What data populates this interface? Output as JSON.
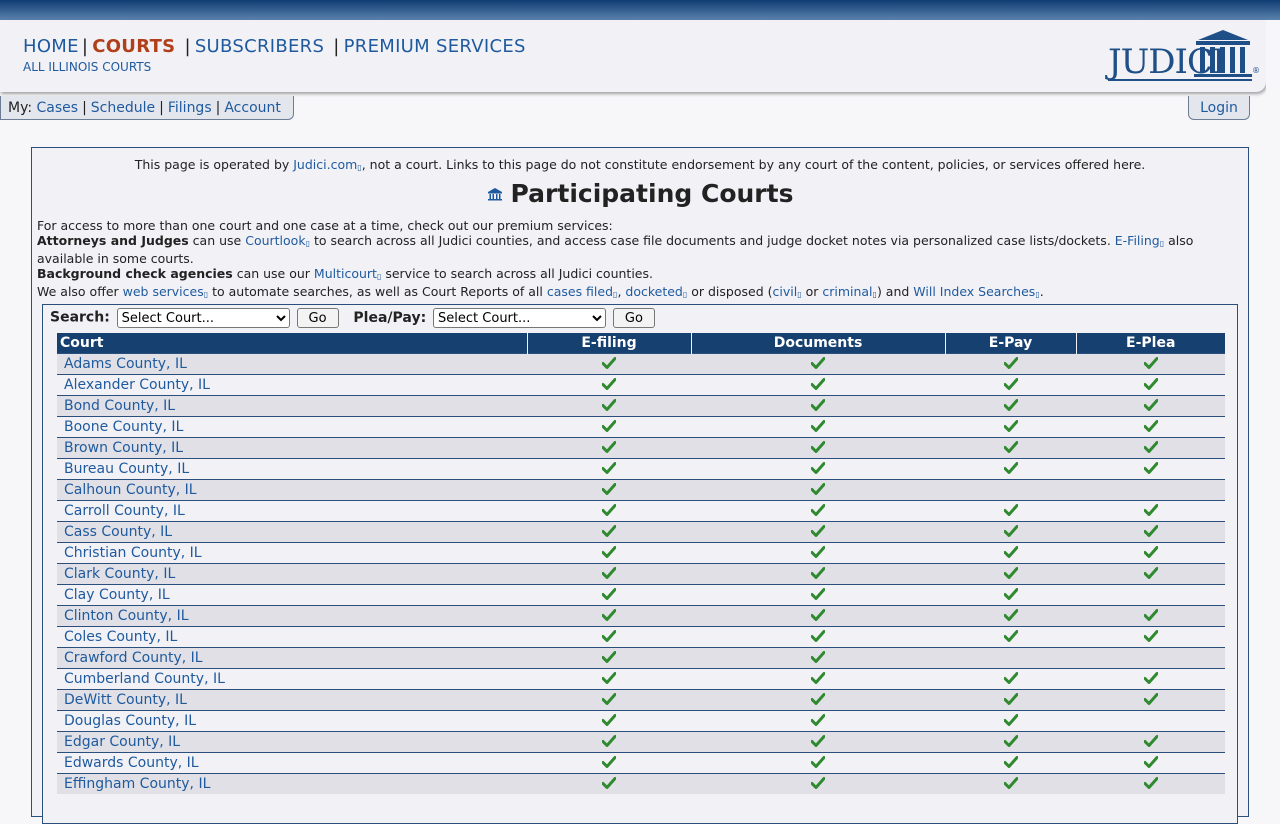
{
  "nav": {
    "items": [
      "HOME",
      "COURTS",
      "SUBSCRIBERS",
      "PREMIUM SERVICES"
    ],
    "active": "COURTS",
    "sub": "ALL ILLINOIS COURTS"
  },
  "logo": {
    "text": "JUDICI",
    "mark": "®"
  },
  "mybar": {
    "prefix": "My:",
    "links": [
      "Cases",
      "Schedule",
      "Filings",
      "Account"
    ]
  },
  "login": "Login",
  "notice": {
    "pre": "This page is operated by ",
    "link": "Judici.com",
    "post": ", not a court. Links to this page do not constitute endorsement by any court of the content, policies, or services offered here."
  },
  "title": "Participating Courts",
  "intro": {
    "line1": "For access to more than one court and one case at a time, check out our premium services:",
    "attorneys_bold": "Attorneys and Judges",
    "attorneys_pre": " can use ",
    "courtlook": "Courtlook",
    "attorneys_mid": " to search across all Judici counties, and access case file documents and judge docket notes via personalized case lists/dockets. ",
    "efiling": "E-Filing",
    "attorneys_post": " also available in some courts.",
    "background_bold": "Background check agencies",
    "background_pre": " can use our ",
    "multicourt": "Multicourt",
    "background_post": " service to search across all Judici counties.",
    "also_pre": "We also offer ",
    "web_services": "web services",
    "also_mid1": " to automate searches, as well as Court Reports of all ",
    "cases_filed": "cases filed",
    "comma": ", ",
    "docketed": "docketed",
    "also_mid2": " or disposed (",
    "civil": "civil",
    "or": " or ",
    "criminal": "criminal",
    "also_mid3": ") and ",
    "will_index": "Will Index Searches",
    "period": "."
  },
  "search": {
    "label": "Search:",
    "select": "Select Court...",
    "go": "Go",
    "plea_label": "Plea/Pay:",
    "plea_select": "Select Court...",
    "plea_go": "Go"
  },
  "table": {
    "headers": [
      "Court",
      "E-filing",
      "Documents",
      "E-Pay",
      "E-Plea"
    ],
    "rows": [
      {
        "court": "Adams County, IL",
        "efiling": true,
        "documents": true,
        "epay": true,
        "eplea": true
      },
      {
        "court": "Alexander County, IL",
        "efiling": true,
        "documents": true,
        "epay": true,
        "eplea": true
      },
      {
        "court": "Bond County, IL",
        "efiling": true,
        "documents": true,
        "epay": true,
        "eplea": true
      },
      {
        "court": "Boone County, IL",
        "efiling": true,
        "documents": true,
        "epay": true,
        "eplea": true
      },
      {
        "court": "Brown County, IL",
        "efiling": true,
        "documents": true,
        "epay": true,
        "eplea": true
      },
      {
        "court": "Bureau County, IL",
        "efiling": true,
        "documents": true,
        "epay": true,
        "eplea": true
      },
      {
        "court": "Calhoun County, IL",
        "efiling": true,
        "documents": true,
        "epay": false,
        "eplea": false
      },
      {
        "court": "Carroll County, IL",
        "efiling": true,
        "documents": true,
        "epay": true,
        "eplea": true
      },
      {
        "court": "Cass County, IL",
        "efiling": true,
        "documents": true,
        "epay": true,
        "eplea": true
      },
      {
        "court": "Christian County, IL",
        "efiling": true,
        "documents": true,
        "epay": true,
        "eplea": true
      },
      {
        "court": "Clark County, IL",
        "efiling": true,
        "documents": true,
        "epay": true,
        "eplea": true
      },
      {
        "court": "Clay County, IL",
        "efiling": true,
        "documents": true,
        "epay": true,
        "eplea": false
      },
      {
        "court": "Clinton County, IL",
        "efiling": true,
        "documents": true,
        "epay": true,
        "eplea": true
      },
      {
        "court": "Coles County, IL",
        "efiling": true,
        "documents": true,
        "epay": true,
        "eplea": true
      },
      {
        "court": "Crawford County, IL",
        "efiling": true,
        "documents": true,
        "epay": false,
        "eplea": false
      },
      {
        "court": "Cumberland County, IL",
        "efiling": true,
        "documents": true,
        "epay": true,
        "eplea": true
      },
      {
        "court": "DeWitt County, IL",
        "efiling": true,
        "documents": true,
        "epay": true,
        "eplea": true
      },
      {
        "court": "Douglas County, IL",
        "efiling": true,
        "documents": true,
        "epay": true,
        "eplea": false
      },
      {
        "court": "Edgar County, IL",
        "efiling": true,
        "documents": true,
        "epay": true,
        "eplea": true
      },
      {
        "court": "Edwards County, IL",
        "efiling": true,
        "documents": true,
        "epay": true,
        "eplea": true
      },
      {
        "court": "Effingham County, IL",
        "efiling": true,
        "documents": true,
        "epay": true,
        "eplea": true
      }
    ]
  },
  "colors": {
    "check": "#2f8a2f",
    "header_bg": "#16406f",
    "link": "#1f5a9e",
    "active_nav": "#b1401a"
  }
}
